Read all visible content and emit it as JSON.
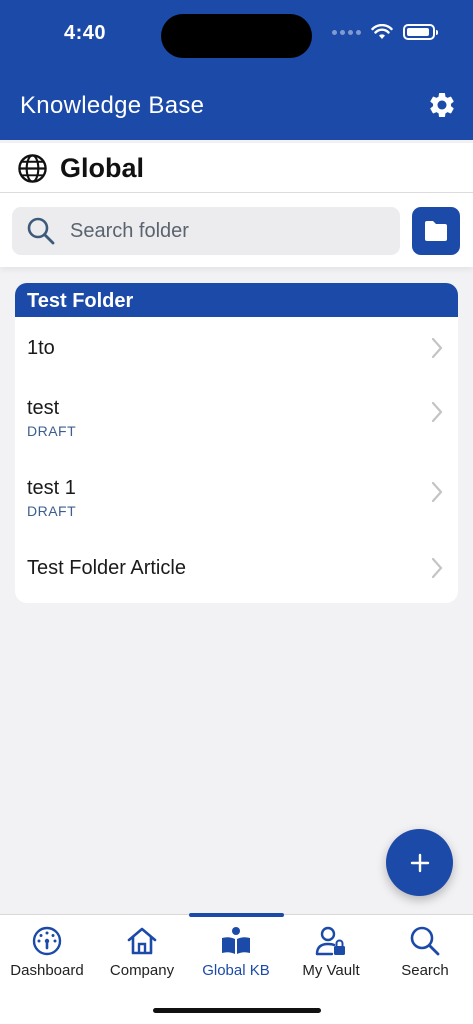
{
  "status_bar": {
    "time": "4:40"
  },
  "header": {
    "title": "Knowledge Base",
    "settings_icon": "gear-icon"
  },
  "scope": {
    "title": "Global",
    "icon": "globe-icon"
  },
  "search": {
    "placeholder": "Search folder",
    "value": ""
  },
  "folder": {
    "name": "Test Folder",
    "articles": [
      {
        "title": "1to",
        "status": ""
      },
      {
        "title": "test",
        "status": "DRAFT"
      },
      {
        "title": "test 1",
        "status": "DRAFT"
      },
      {
        "title": "Test Folder Article",
        "status": ""
      }
    ]
  },
  "fab": {
    "icon": "plus-icon"
  },
  "tabs": [
    {
      "label": "Dashboard",
      "icon": "dashboard-gauge-icon",
      "active": false
    },
    {
      "label": "Company",
      "icon": "home-icon",
      "active": false
    },
    {
      "label": "Global KB",
      "icon": "open-book-icon",
      "active": true
    },
    {
      "label": "My Vault",
      "icon": "user-lock-icon",
      "active": false
    },
    {
      "label": "Search",
      "icon": "search-icon",
      "active": false
    }
  ],
  "colors": {
    "primary": "#1c4aa8",
    "background": "#f2f2f4",
    "draft_text": "#3b5f8e"
  }
}
